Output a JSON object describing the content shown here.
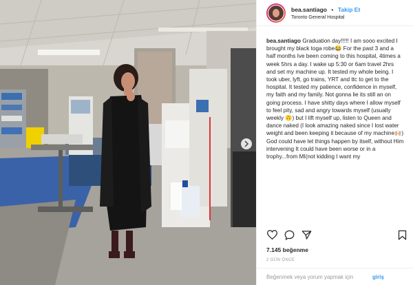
{
  "header": {
    "username": "bea.santiago",
    "separator": "•",
    "follow_label": "Takip Et",
    "location": "Toronto General Hospital"
  },
  "caption": {
    "username": "bea.santiago",
    "text": "Graduation day!!!!! I am sooo excited I brought my black toga robe😂 For the past 3 and a half months Ive been coming to this hospital, 4times a week 5hrs a day. I wake up 5:30 or 6am travel 2hrs and set my machine up. It tested my whole being. I took uber, lyft, go trains, YRT and ttc to get to the hospital. It tested my patience, confidence in myself, my faith and my family. Not gonna lie its still an on going process. I have shitty days where I allow myself to feel pity, sad and angry towards myself (usually weekly 🙃) but I lift myself up, listen to Queen and dance naked (I look amazing naked since I lost water weight and been keeping it because of my machine🙌🏼) God could have let things happen by itself, without Him intervening It could have been worse or in a trophy...from MI(not kidding I want my"
  },
  "actions": {
    "like_icon": "heart-icon",
    "comment_icon": "comment-icon",
    "share_icon": "share-icon",
    "save_icon": "bookmark-icon"
  },
  "likes": "7.145 beğenme",
  "time": "2 GÜN ÖNCE",
  "comment": {
    "placeholder": "Beğenmek veya yorum yapmak için",
    "post_label": "giriş"
  },
  "colors": {
    "accent": "#3897f0",
    "text": "#262626",
    "muted": "#999999"
  }
}
